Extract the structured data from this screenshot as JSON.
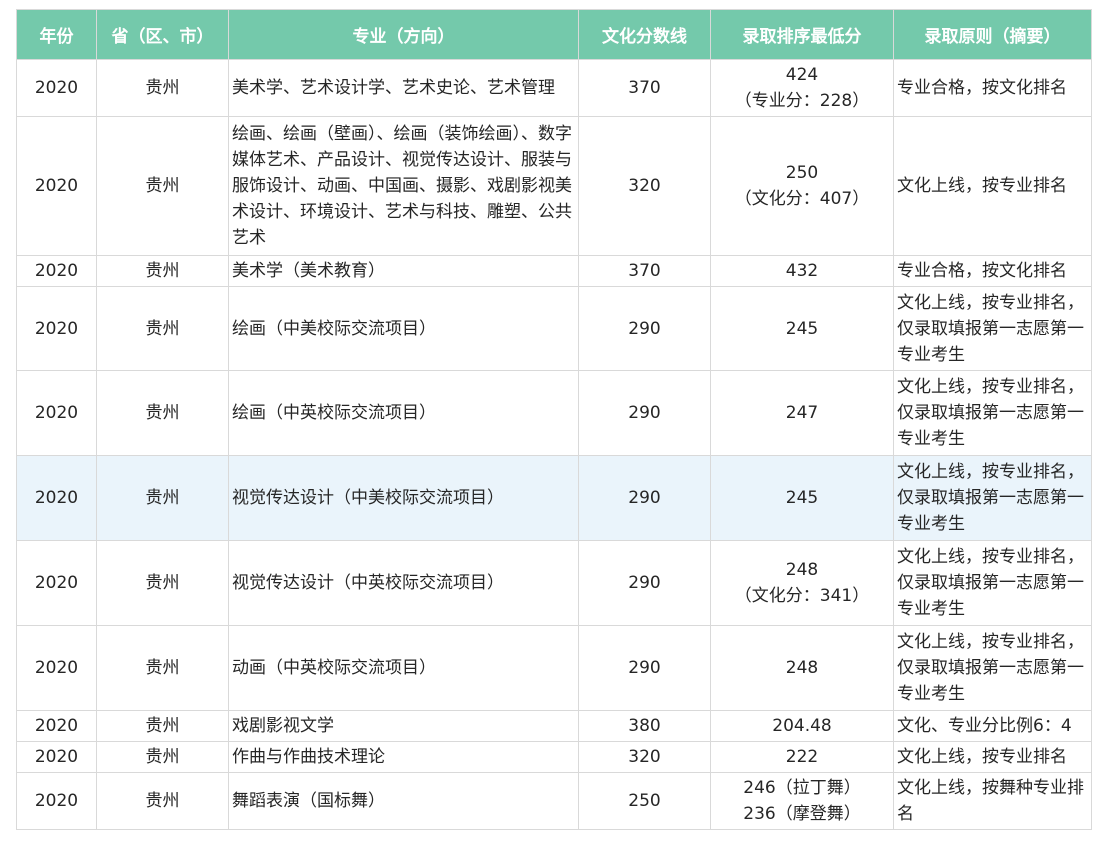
{
  "headers": {
    "year": "年份",
    "province": "省（区、市）",
    "major": "专业（方向）",
    "culture_line": "文化分数线",
    "min_score": "录取排序最低分",
    "principle": "录取原则（摘要）"
  },
  "rows": [
    {
      "year": "2020",
      "province": "贵州",
      "major": "美术学、艺术设计学、艺术史论、艺术管理",
      "culture_line": "370",
      "min_score_1": "424",
      "min_score_2": "（专业分：228）",
      "principle": "专业合格，按文化排名"
    },
    {
      "year": "2020",
      "province": "贵州",
      "major": "绘画、绘画（壁画）、绘画（装饰绘画）、数字媒体艺术、产品设计、视觉传达设计、服装与服饰设计、动画、中国画、摄影、戏剧影视美术设计、环境设计、艺术与科技、雕塑、公共艺术",
      "culture_line": "320",
      "min_score_1": "250",
      "min_score_2": "（文化分：407）",
      "principle": "文化上线，按专业排名"
    },
    {
      "year": "2020",
      "province": "贵州",
      "major": "美术学（美术教育）",
      "culture_line": "370",
      "min_score_1": "432",
      "min_score_2": "",
      "principle": "专业合格，按文化排名"
    },
    {
      "year": "2020",
      "province": "贵州",
      "major": "绘画（中美校际交流项目）",
      "culture_line": "290",
      "min_score_1": "245",
      "min_score_2": "",
      "principle": "文化上线，按专业排名，仅录取填报第一志愿第一专业考生"
    },
    {
      "year": "2020",
      "province": "贵州",
      "major": "绘画（中英校际交流项目）",
      "culture_line": "290",
      "min_score_1": "247",
      "min_score_2": "",
      "principle": "文化上线，按专业排名，仅录取填报第一志愿第一专业考生"
    },
    {
      "year": "2020",
      "province": "贵州",
      "major": "视觉传达设计（中美校际交流项目）",
      "culture_line": "290",
      "min_score_1": "245",
      "min_score_2": "",
      "principle": "文化上线，按专业排名，仅录取填报第一志愿第一专业考生"
    },
    {
      "year": "2020",
      "province": "贵州",
      "major": "视觉传达设计（中英校际交流项目）",
      "culture_line": "290",
      "min_score_1": "248",
      "min_score_2": "（文化分：341）",
      "principle": "文化上线，按专业排名，仅录取填报第一志愿第一专业考生"
    },
    {
      "year": "2020",
      "province": "贵州",
      "major": "动画（中英校际交流项目）",
      "culture_line": "290",
      "min_score_1": "248",
      "min_score_2": "",
      "principle": "文化上线，按专业排名，仅录取填报第一志愿第一专业考生"
    },
    {
      "year": "2020",
      "province": "贵州",
      "major": "戏剧影视文学",
      "culture_line": "380",
      "min_score_1": "204.48",
      "min_score_2": "",
      "principle": "文化、专业分比例6：4"
    },
    {
      "year": "2020",
      "province": "贵州",
      "major": "作曲与作曲技术理论",
      "culture_line": "320",
      "min_score_1": "222",
      "min_score_2": "",
      "principle": "文化上线，按专业排名"
    },
    {
      "year": "2020",
      "province": "贵州",
      "major": "舞蹈表演（国标舞）",
      "culture_line": "250",
      "min_score_1": "246（拉丁舞）",
      "min_score_2": "236（摩登舞）",
      "principle": "文化上线，按舞种专业排名"
    }
  ],
  "colors": {
    "header_bg": "#74c9ab",
    "highlight_row": "#eaf4fb"
  }
}
